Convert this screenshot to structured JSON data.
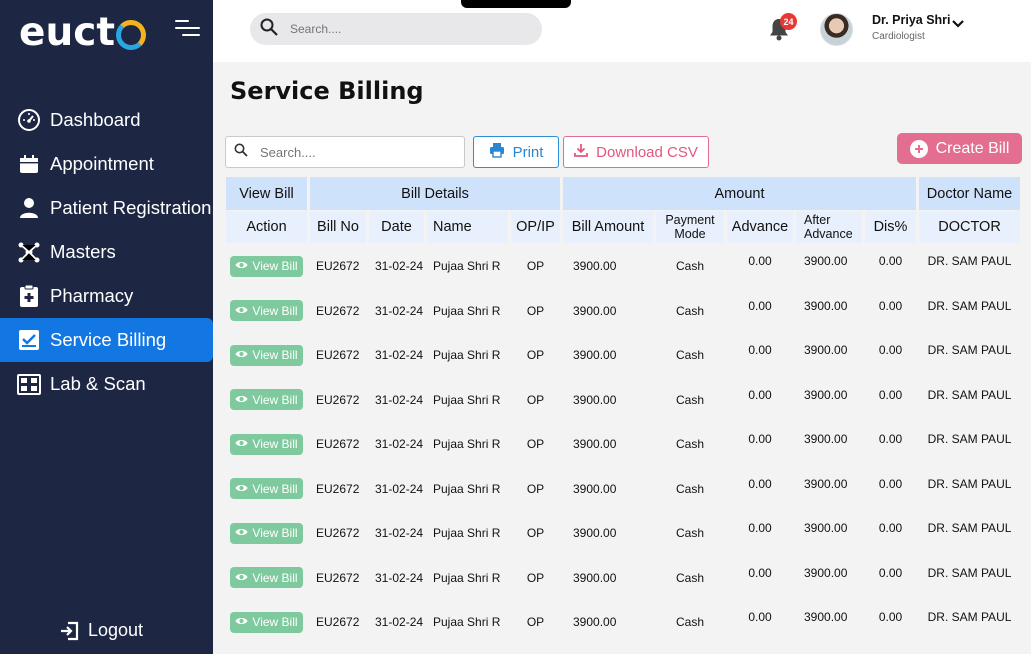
{
  "app": {
    "logo_text": "euct"
  },
  "colors": {
    "sidebar": "#1d2744",
    "active": "#1277e2",
    "print": "#2b86d0",
    "csv": "#e2577d",
    "create": "#e46e8f",
    "view": "#7fc99e",
    "header": "#cfe2fb"
  },
  "sidebar": {
    "items": [
      {
        "label": "Dashboard",
        "icon": "dashboard-gauge-icon"
      },
      {
        "label": "Appointment",
        "icon": "calendar-icon"
      },
      {
        "label": "Patient Registration",
        "icon": "person-icon"
      },
      {
        "label": "Masters",
        "icon": "network-icon"
      },
      {
        "label": "Pharmacy",
        "icon": "clipboard-plus-icon"
      },
      {
        "label": "Service Billing",
        "icon": "billing-icon",
        "active": true
      },
      {
        "label": "Lab & Scan",
        "icon": "lab-icon"
      }
    ],
    "logout": "Logout"
  },
  "topbar": {
    "search_placeholder": "Search....",
    "notifications": "24",
    "user_name": "Dr. Priya Shri",
    "user_role": "Cardiologist"
  },
  "page": {
    "title": "Service Billing",
    "search_placeholder": "Search....",
    "print_label": "Print",
    "csv_label": "Download CSV",
    "create_label": "Create Bill"
  },
  "table": {
    "groups": [
      "View Bill",
      "Bill Details",
      "Amount",
      "Doctor Name"
    ],
    "columns": {
      "action": "Action",
      "bill_no": "Bill No",
      "date": "Date",
      "name": "Name",
      "opip": "OP/IP",
      "bill_amount": "Bill Amount",
      "payment_mode_1": "Payment",
      "payment_mode_2": "Mode",
      "advance": "Advance",
      "after_advance_1": "After",
      "after_advance_2": "Advance",
      "dis": "Dis%",
      "doctor": "DOCTOR"
    },
    "view_label": "View Bill",
    "rows": [
      {
        "bill_no": "EU2672",
        "date": "31-02-24",
        "name": "Pujaa Shri R",
        "opip": "OP",
        "bill_amount": "3900.00",
        "mode": "Cash",
        "advance": "0.00",
        "after_advance": "3900.00",
        "dis": "0.00",
        "doctor": "DR. SAM PAUL"
      },
      {
        "bill_no": "EU2672",
        "date": "31-02-24",
        "name": "Pujaa Shri R",
        "opip": "OP",
        "bill_amount": "3900.00",
        "mode": "Cash",
        "advance": "0.00",
        "after_advance": "3900.00",
        "dis": "0.00",
        "doctor": "DR. SAM PAUL"
      },
      {
        "bill_no": "EU2672",
        "date": "31-02-24",
        "name": "Pujaa Shri R",
        "opip": "OP",
        "bill_amount": "3900.00",
        "mode": "Cash",
        "advance": "0.00",
        "after_advance": "3900.00",
        "dis": "0.00",
        "doctor": "DR. SAM PAUL"
      },
      {
        "bill_no": "EU2672",
        "date": "31-02-24",
        "name": "Pujaa Shri R",
        "opip": "OP",
        "bill_amount": "3900.00",
        "mode": "Cash",
        "advance": "0.00",
        "after_advance": "3900.00",
        "dis": "0.00",
        "doctor": "DR. SAM PAUL"
      },
      {
        "bill_no": "EU2672",
        "date": "31-02-24",
        "name": "Pujaa Shri R",
        "opip": "OP",
        "bill_amount": "3900.00",
        "mode": "Cash",
        "advance": "0.00",
        "after_advance": "3900.00",
        "dis": "0.00",
        "doctor": "DR. SAM PAUL"
      },
      {
        "bill_no": "EU2672",
        "date": "31-02-24",
        "name": "Pujaa Shri R",
        "opip": "OP",
        "bill_amount": "3900.00",
        "mode": "Cash",
        "advance": "0.00",
        "after_advance": "3900.00",
        "dis": "0.00",
        "doctor": "DR. SAM PAUL"
      },
      {
        "bill_no": "EU2672",
        "date": "31-02-24",
        "name": "Pujaa Shri R",
        "opip": "OP",
        "bill_amount": "3900.00",
        "mode": "Cash",
        "advance": "0.00",
        "after_advance": "3900.00",
        "dis": "0.00",
        "doctor": "DR. SAM PAUL"
      },
      {
        "bill_no": "EU2672",
        "date": "31-02-24",
        "name": "Pujaa Shri R",
        "opip": "OP",
        "bill_amount": "3900.00",
        "mode": "Cash",
        "advance": "0.00",
        "after_advance": "3900.00",
        "dis": "0.00",
        "doctor": "DR. SAM PAUL"
      },
      {
        "bill_no": "EU2672",
        "date": "31-02-24",
        "name": "Pujaa Shri R",
        "opip": "OP",
        "bill_amount": "3900.00",
        "mode": "Cash",
        "advance": "0.00",
        "after_advance": "3900.00",
        "dis": "0.00",
        "doctor": "DR. SAM PAUL"
      }
    ]
  }
}
